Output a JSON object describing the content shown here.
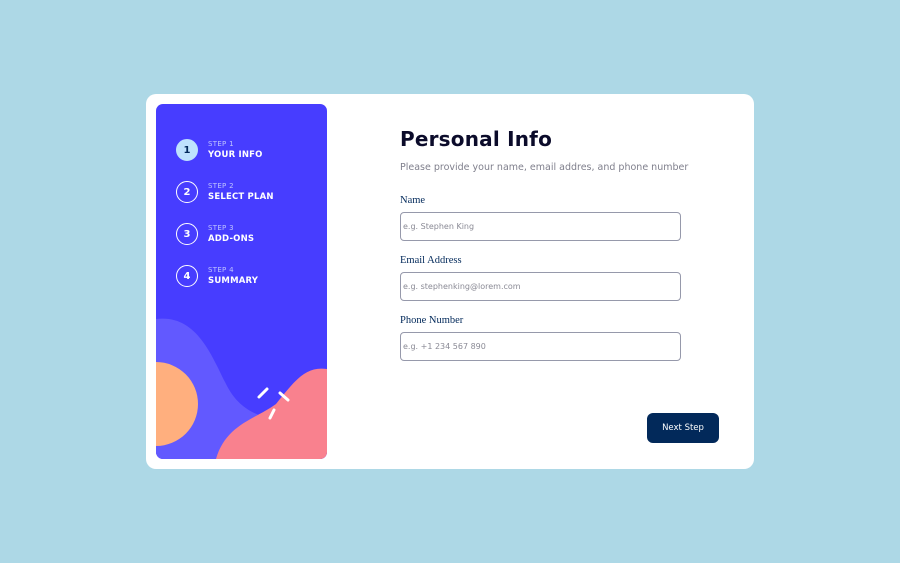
{
  "sidebar": {
    "steps": [
      {
        "number": "1",
        "label": "STEP 1",
        "title": "YOUR INFO"
      },
      {
        "number": "2",
        "label": "STEP 2",
        "title": "SELECT PLAN"
      },
      {
        "number": "3",
        "label": "STEP 3",
        "title": "ADD-ONS"
      },
      {
        "number": "4",
        "label": "STEP 4",
        "title": "SUMMARY"
      }
    ],
    "active_step": 1
  },
  "form": {
    "title": "Personal Info",
    "subtitle": "Please provide your name, email addres, and phone number",
    "fields": [
      {
        "label": "Name",
        "placeholder": "e.g. Stephen King",
        "value": ""
      },
      {
        "label": "Email Address",
        "placeholder": "e.g. stephenking@lorem.com",
        "value": ""
      },
      {
        "label": "Phone Number",
        "placeholder": "e.g. +1 234 567 890",
        "value": ""
      }
    ],
    "next_label": "Next Step"
  },
  "colors": {
    "page_background": "#add8e6",
    "sidebar_background": "#473dff",
    "active_step": "#bee2fd",
    "button": "#02295a",
    "blob_orange": "#ffaf7e",
    "blob_pink": "#f9818e",
    "blob_purple": "#6259ff"
  }
}
